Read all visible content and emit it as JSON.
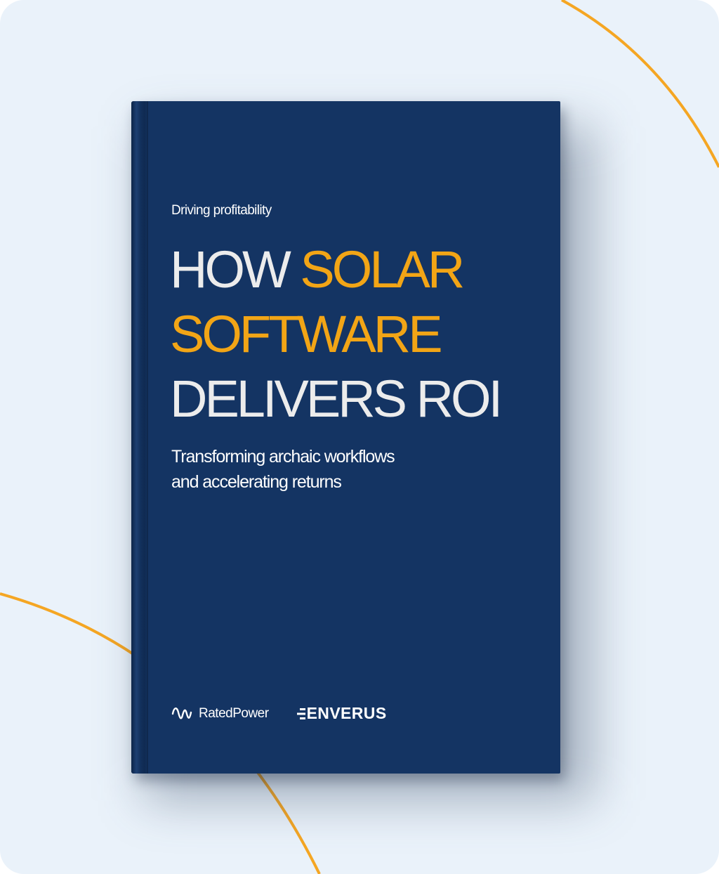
{
  "cover": {
    "eyebrow": "Driving profitability",
    "title_lines": [
      {
        "white": "HOW ",
        "accent": "SOLAR"
      },
      {
        "white": "",
        "accent": "SOFTWARE"
      },
      {
        "white": "DELIVERS ROI",
        "accent": ""
      }
    ],
    "subtitle_lines": [
      "Transforming archaic workflows",
      "and accelerating returns"
    ],
    "logos": [
      {
        "name": "RatedPower",
        "icon": "ratedpower-wave-icon"
      },
      {
        "name": "ENVERUS",
        "icon": "enverus-mark-icon"
      }
    ]
  },
  "colors": {
    "background": "#eaf2fa",
    "book": "#143463",
    "accent": "#f2a516",
    "title_white": "#ececec",
    "arc": "#f5a623"
  }
}
